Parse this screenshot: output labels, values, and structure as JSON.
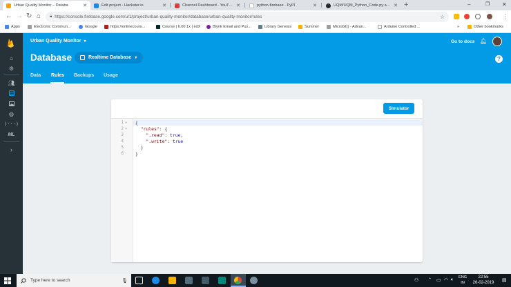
{
  "browser": {
    "tabs": [
      {
        "title": "Urban Quality Monitor – Databa",
        "active": true
      },
      {
        "title": "Edit project - Hackster.io",
        "active": false
      },
      {
        "title": "Channel Dashboard - YouTube S",
        "active": false
      },
      {
        "title": "python-firebase · PyPI",
        "active": false
      },
      {
        "title": "UQM/UQM_Python_Code.py at m",
        "active": false
      }
    ],
    "url": "https://console.firebase.google.com/u/1/project/urban-quality-monitor/database/urban-quality-monitor/rules",
    "bookmarks": [
      "Apps",
      "Electronic Commun...",
      "Google",
      "https://onlinecours...",
      "Course | 6.00.1x | edX",
      "Blynk Email and Pus...",
      "Library Genesis",
      "Summer",
      "Microbit() - Advan...",
      "Arduino Controlled ..."
    ],
    "other_bookmarks": "Other bookmarks",
    "more_bookmarks": "»"
  },
  "firebase": {
    "project_name": "Urban Quality Monitor",
    "page_title": "Database",
    "db_selector": "Realtime Database",
    "go_to_docs": "Go to docs",
    "tabs": [
      "Data",
      "Rules",
      "Backups",
      "Usage"
    ],
    "active_tab": "Rules",
    "simulator_label": "Simulator",
    "code_lines": [
      {
        "num": "1",
        "fold": "▾",
        "text": "{"
      },
      {
        "num": "2",
        "fold": "▾",
        "text": "  \"rules\": {"
      },
      {
        "num": "3",
        "fold": "",
        "text": "    \".read\": true,"
      },
      {
        "num": "4",
        "fold": "",
        "text": "    \".write\": true"
      },
      {
        "num": "5",
        "fold": "",
        "text": "  }"
      },
      {
        "num": "6",
        "fold": "",
        "text": "}"
      }
    ]
  },
  "taskbar": {
    "search_placeholder": "Type here to search",
    "lang_top": "ENG",
    "lang_bottom": "IN",
    "time": "22:55",
    "date": "26-02-2019"
  },
  "colors": {
    "firebase_blue": "#039be5",
    "rail": "#263238",
    "taskbar": "#101820"
  }
}
